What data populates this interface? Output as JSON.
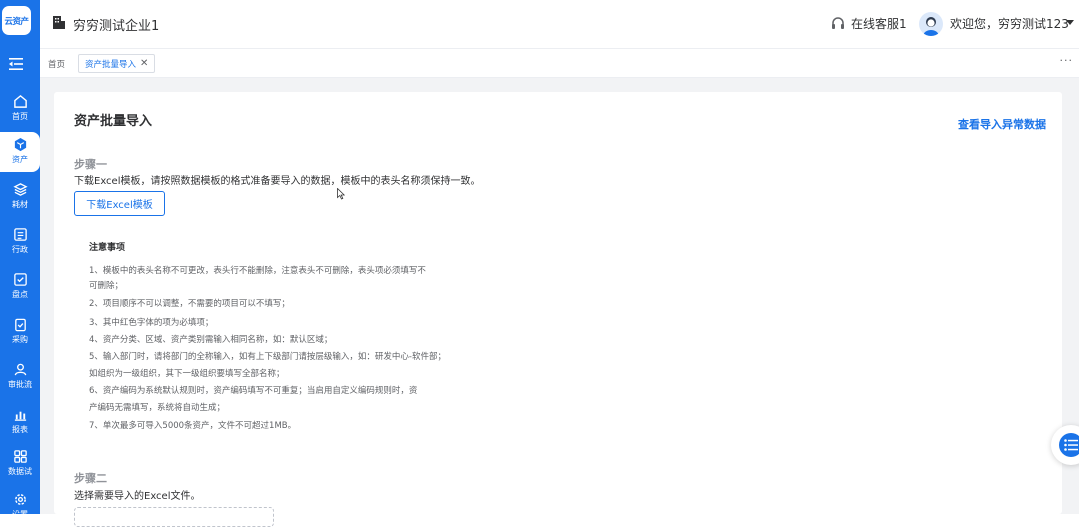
{
  "app": {
    "logo_text": "云资产"
  },
  "sidebar": {
    "items": [
      {
        "label": "首页",
        "icon": "home-icon"
      },
      {
        "label": "资产",
        "icon": "asset-icon"
      },
      {
        "label": "耗材",
        "icon": "layers-icon"
      },
      {
        "label": "行政",
        "icon": "list-icon"
      },
      {
        "label": "盘点",
        "icon": "check-icon"
      },
      {
        "label": "采购",
        "icon": "clipboard-icon"
      },
      {
        "label": "审批流",
        "icon": "user-icon"
      },
      {
        "label": "报表",
        "icon": "chart-icon"
      },
      {
        "label": "数据试",
        "icon": "grid-icon"
      },
      {
        "label": "设置",
        "icon": "gear-icon"
      }
    ]
  },
  "header": {
    "company": "穷穷测试企业1",
    "service": "在线客服1",
    "user": "欢迎您，穷穷测试123"
  },
  "tabs": [
    {
      "label": "首页"
    },
    {
      "label": "资产批量导入"
    }
  ],
  "tabs_more": "···",
  "page": {
    "title": "资产批量导入",
    "view_errors": "查看导入异常数据",
    "step1": {
      "title": "步骤一",
      "desc": "下载Excel模板，请按照数据模板的格式准备要导入的数据，模板中的表头名称须保持一致。",
      "button": "下载Excel模板"
    },
    "notes": {
      "title": "注意事项",
      "lines": [
        "1、模板中的表头名称不可更改，表头行不能删除，注意表头不可删除，表头项必须填写不",
        "可删除；",
        "2、项目顺序不可以调整，不需要的项目可以不填写；",
        "3、其中红色字体的项为必填项；",
        "4、资产分类、区域、资产类别需输入相同名称，如：默认区域；",
        "5、输入部门时，请将部门的全称输入，如有上下级部门请按层级输入，如：研发中心-软件部；",
        "如组织为一级组织，其下一级组织要填写全部名称；",
        "6、资产编码为系统默认规则时，资产编码填写不可重复；当启用自定义编码规则时，资",
        "产编码无需填写，系统将自动生成；",
        "7、单次最多可导入5000条资产，文件不可超过1MB。"
      ]
    },
    "step2": {
      "title": "步骤二",
      "desc": "选择需要导入的Excel文件。"
    }
  },
  "colors": {
    "primary": "#1a73e8",
    "background": "#f2f3f5"
  }
}
